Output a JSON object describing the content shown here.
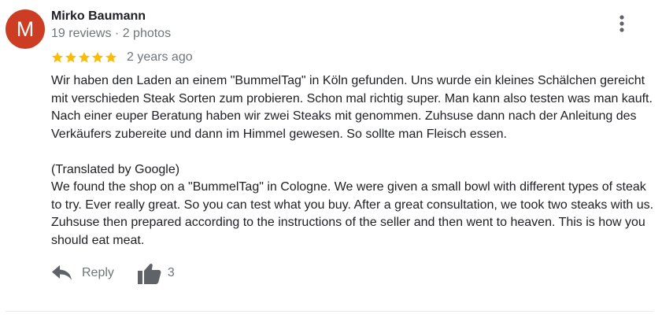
{
  "review": {
    "author": {
      "initial": "M",
      "name": "Mirko Baumann",
      "meta": "19 reviews · 2 photos",
      "avatar_color": "#cc3d24"
    },
    "rating": 5,
    "rating_max": 5,
    "star_color": "#fbbc04",
    "star_icon": "star-icon",
    "date": "2 years ago",
    "original_text": "Wir haben den Laden an einem \"BummelTag\" in Köln gefunden. Uns wurde ein kleines Schälchen gereicht mit verschieden Steak Sorten zum probieren. Schon mal richtig super. Man kann also testen was man kauft. Nach einer euper Beratung haben wir zwei Steaks mit genommen. Zuhsuse dann nach der Anleitung des Verkäufers zubereite und dann im Himmel gewesen. So sollte man Fleisch essen.",
    "translation_label": "(Translated by Google)",
    "translated_text": "We found the shop on a \"BummelTag\" in Cologne. We were given a small bowl with different types of steak to try. Ever really great. So you can test what you buy. After a great consultation, we took two steaks with us. Zuhsuse then prepared according to the instructions of the seller and then went to heaven. This is how you should eat meat.",
    "actions": {
      "reply_label": "Reply",
      "reply_icon": "reply-icon",
      "like_icon": "thumbs-up-icon",
      "like_count": "3"
    },
    "more_icon": "more-vert-icon"
  }
}
